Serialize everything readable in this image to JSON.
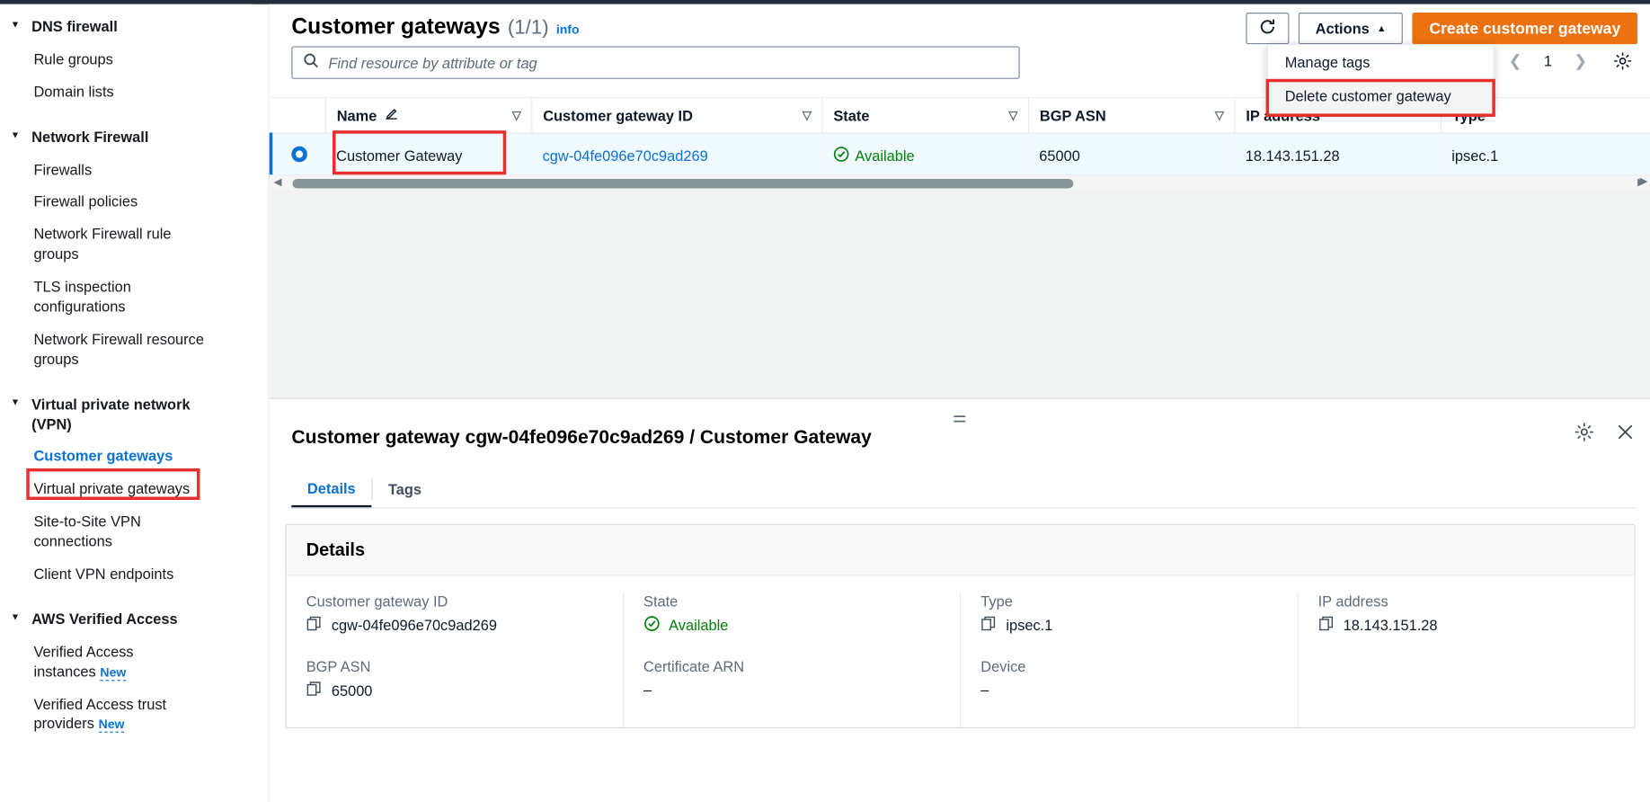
{
  "sidebar": {
    "groups": [
      {
        "title": "DNS firewall",
        "caret": "triangle-down-icon",
        "items": [
          {
            "label": "Rule groups"
          },
          {
            "label": "Domain lists"
          }
        ]
      },
      {
        "title": "Network Firewall",
        "caret": "triangle-down-icon",
        "items": [
          {
            "label": "Firewalls"
          },
          {
            "label": "Firewall policies"
          },
          {
            "label": "Network Firewall rule groups"
          },
          {
            "label": "TLS inspection configurations"
          },
          {
            "label": "Network Firewall resource groups"
          }
        ]
      },
      {
        "title": "Virtual private network (VPN)",
        "caret": "triangle-down-icon",
        "items": [
          {
            "label": "Customer gateways",
            "selected": true,
            "highlighted": true
          },
          {
            "label": "Virtual private gateways"
          },
          {
            "label": "Site-to-Site VPN connections"
          },
          {
            "label": "Client VPN endpoints"
          }
        ]
      },
      {
        "title": "AWS Verified Access",
        "caret": "triangle-down-icon",
        "items": [
          {
            "label": "Verified Access instances",
            "badge": "New"
          },
          {
            "label": "Verified Access trust providers",
            "badge": "New"
          }
        ]
      }
    ]
  },
  "header": {
    "title": "Customer gateways",
    "count": "(1/1)",
    "info_label": "info",
    "refresh_icon": "refresh-icon",
    "actions_label": "Actions",
    "actions_caret": "caret-up-icon",
    "create_label": "Create customer gateway"
  },
  "search": {
    "icon": "search-icon",
    "placeholder": "Find resource by attribute or tag",
    "value": ""
  },
  "dropdown": {
    "items": [
      {
        "label": "Manage tags",
        "highlighted": false
      },
      {
        "label": "Delete customer gateway",
        "highlighted": true
      }
    ]
  },
  "pagination": {
    "prev_icon": "chevron-left-icon",
    "page": "1",
    "next_icon": "chevron-right-icon",
    "settings_icon": "gear-icon"
  },
  "table": {
    "columns": [
      {
        "label": "Name",
        "edit_icon": "pencil-icon",
        "sort_icon": "sort-caret-icon"
      },
      {
        "label": "Customer gateway ID",
        "sort_icon": "sort-caret-icon"
      },
      {
        "label": "State",
        "sort_icon": "sort-caret-icon"
      },
      {
        "label": "BGP ASN",
        "sort_icon": "sort-caret-icon"
      },
      {
        "label": "IP address"
      },
      {
        "label": "Type"
      }
    ],
    "rows": [
      {
        "selected": true,
        "radio_icon": "radio-selected-icon",
        "name": "Customer Gateway",
        "name_highlighted": true,
        "id": "cgw-04fe096e70c9ad269",
        "state": "Available",
        "state_icon": "check-circle-icon",
        "bgp_asn": "65000",
        "ip_address": "18.143.151.28",
        "type": "ipsec.1"
      }
    ],
    "h_scroll": {
      "left_arrow": "triangle-left-icon",
      "right_arrow": "triangle-right-icon"
    }
  },
  "split_panel": {
    "drag_handle_icon": "drag-handle-icon",
    "title": "Customer gateway cgw-04fe096e70c9ad269 / Customer Gateway",
    "settings_icon": "gear-icon",
    "close_icon": "close-icon",
    "tabs": [
      {
        "label": "Details",
        "active": true
      },
      {
        "label": "Tags",
        "active": false
      }
    ],
    "details_card": {
      "heading": "Details",
      "columns": [
        {
          "fields": [
            {
              "label": "Customer gateway ID",
              "value": "cgw-04fe096e70c9ad269",
              "copy_icon": "copy-icon"
            },
            {
              "label": "BGP ASN",
              "value": "65000",
              "copy_icon": "copy-icon"
            }
          ]
        },
        {
          "fields": [
            {
              "label": "State",
              "value": "Available",
              "status_icon": "check-circle-icon"
            },
            {
              "label": "Certificate ARN",
              "value": "–"
            }
          ]
        },
        {
          "fields": [
            {
              "label": "Type",
              "value": "ipsec.1",
              "copy_icon": "copy-icon"
            },
            {
              "label": "Device",
              "value": "–"
            }
          ]
        },
        {
          "fields": [
            {
              "label": "IP address",
              "value": "18.143.151.28",
              "copy_icon": "copy-icon"
            }
          ]
        }
      ]
    }
  },
  "colors": {
    "accent_blue": "#0972d3",
    "orange": "#ec7211",
    "green": "#037f0c",
    "highlight_red": "#e8312f",
    "dark_navy": "#232f3e"
  }
}
